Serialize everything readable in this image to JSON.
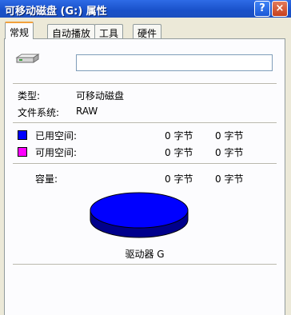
{
  "window": {
    "title": "可移动磁盘 (G:) 属性",
    "help_button": "?",
    "close_button": "×"
  },
  "tabs": [
    {
      "label": "常规",
      "active": true
    },
    {
      "label": "自动播放",
      "active": false
    },
    {
      "label": "工具",
      "active": false
    },
    {
      "label": "硬件",
      "active": false
    }
  ],
  "general": {
    "volume_name_value": "",
    "type_label": "类型:",
    "type_value": "可移动磁盘",
    "fs_label": "文件系统:",
    "fs_value": "RAW",
    "used_label": "已用空间:",
    "used_bytes": "0 字节",
    "used_size": "0 字节",
    "free_label": "可用空间:",
    "free_bytes": "0 字节",
    "free_size": "0 字节",
    "capacity_label": "容量:",
    "capacity_bytes": "0 字节",
    "capacity_size": "0 字节",
    "drive_label": "驱动器 G"
  },
  "colors": {
    "used": "#0000ff",
    "free": "#ff00ff"
  },
  "icons": {
    "drive": "removable-drive-icon"
  }
}
